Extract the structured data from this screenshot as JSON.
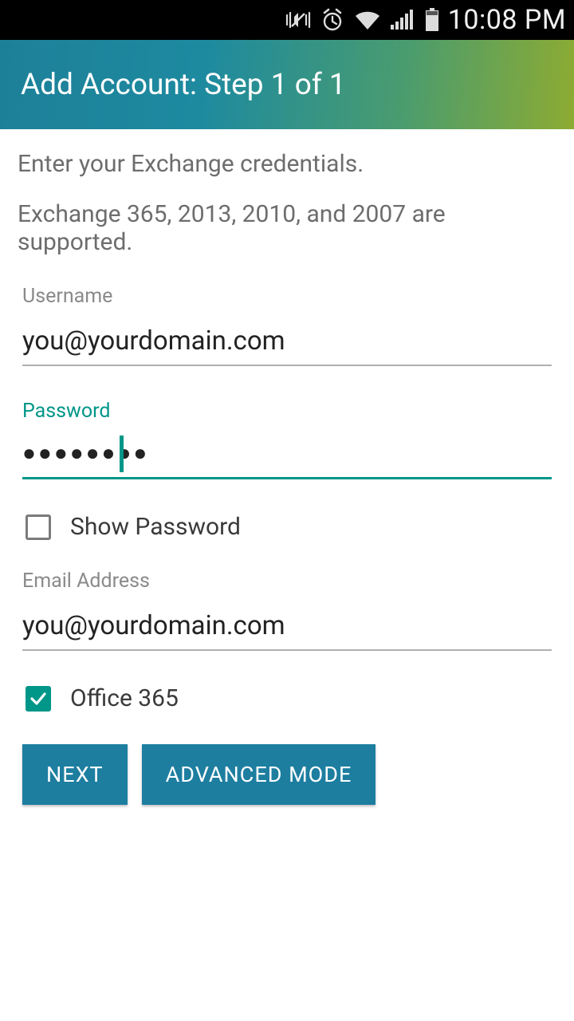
{
  "status": {
    "time": "10:08 PM"
  },
  "appbar": {
    "title": "Add Account: Step 1 of 1"
  },
  "intro": {
    "line1": "Enter your Exchange credentials.",
    "line2": "Exchange 365, 2013, 2010, and 2007 are supported."
  },
  "fields": {
    "username": {
      "label": "Username",
      "value": "you@yourdomain.com"
    },
    "password": {
      "label": "Password",
      "masked": "●●●●●●●●"
    },
    "email": {
      "label": "Email Address",
      "value": "you@yourdomain.com"
    }
  },
  "checkboxes": {
    "show_password": {
      "label": "Show Password",
      "checked": false
    },
    "office365": {
      "label": "Office 365",
      "checked": true
    }
  },
  "buttons": {
    "next": "NEXT",
    "advanced": "ADVANCED MODE"
  }
}
